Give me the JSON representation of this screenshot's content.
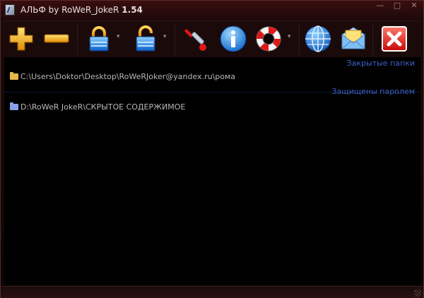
{
  "window": {
    "title": "АЛЬФ by RoWeR_JokeR",
    "version": "1.54"
  },
  "caption_buttons": {
    "minimize": "—",
    "maximize": "□",
    "close": "✕"
  },
  "toolbar": {
    "buttons": [
      {
        "icon": "plus-icon"
      },
      {
        "icon": "minus-icon"
      },
      {
        "icon": "lock-icon",
        "has_dropdown": true
      },
      {
        "icon": "unlock-icon",
        "has_dropdown": true
      },
      {
        "icon": "wrench-icon"
      },
      {
        "icon": "info-icon"
      },
      {
        "icon": "lifebuoy-icon",
        "has_dropdown": true
      },
      {
        "icon": "globe-icon"
      },
      {
        "icon": "mail-icon"
      },
      {
        "icon": "exit-icon"
      }
    ],
    "dropdown_glyph": "▾"
  },
  "sections": [
    {
      "header": "Закрытые папки",
      "items": [
        {
          "path": "C:\\Users\\Doktor\\Desktop\\RoWeRJoker@yandex.ru\\рома",
          "icon": "folder-icon",
          "color": "#e8b84a"
        }
      ]
    },
    {
      "header": "Защищены паролем",
      "items": [
        {
          "path": "D:\\RoWeR JokeR\\СКРЫТОЕ СОДЕРЖИМОЕ",
          "icon": "folder-icon",
          "color": "#8a9ee8"
        }
      ]
    }
  ],
  "colors": {
    "background": "#000000",
    "frame": "#1c0a0a",
    "section_header": "#3d62c8",
    "item_text": "#b8b8b8"
  }
}
